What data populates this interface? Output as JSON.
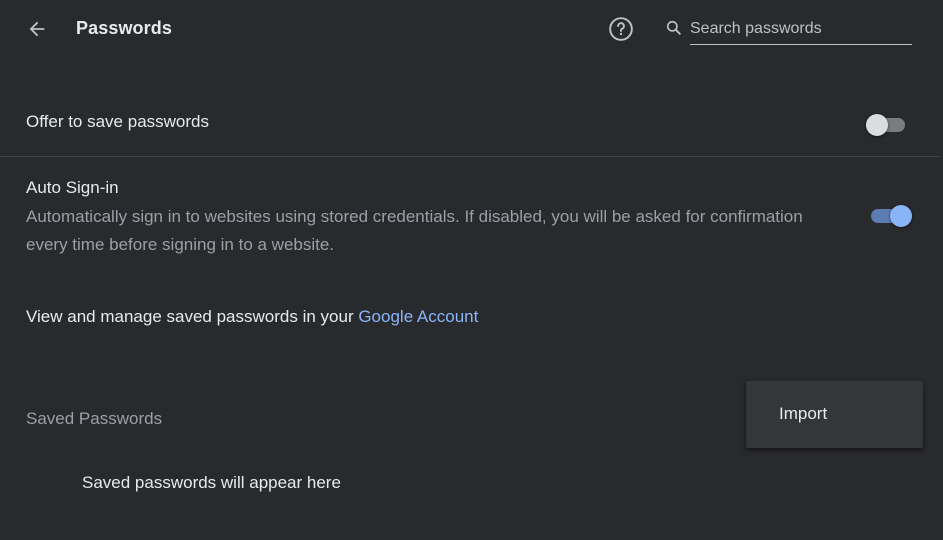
{
  "header": {
    "title": "Passwords",
    "back_icon": "arrow-left-icon",
    "help_icon": "help-circle-icon",
    "search": {
      "placeholder": "Search passwords",
      "value": "",
      "icon": "search-icon"
    }
  },
  "settings": {
    "offer_to_save": {
      "label": "Offer to save passwords",
      "enabled": false
    },
    "auto_signin": {
      "label": "Auto Sign-in",
      "description": "Automatically sign in to websites using stored credentials. If disabled, you will be asked for confirmation every time before signing in to a website.",
      "enabled": true
    },
    "manage": {
      "text": "View and manage saved passwords in your ",
      "link_text": "Google Account"
    }
  },
  "saved_passwords": {
    "title": "Saved Passwords",
    "empty_message": "Saved passwords will appear here"
  },
  "menu": {
    "items": [
      {
        "label": "Import"
      }
    ]
  },
  "colors": {
    "background": "#292a2d",
    "accent": "#8ab4f8",
    "text_primary": "#e8eaed",
    "text_secondary": "#9aa0a6"
  }
}
